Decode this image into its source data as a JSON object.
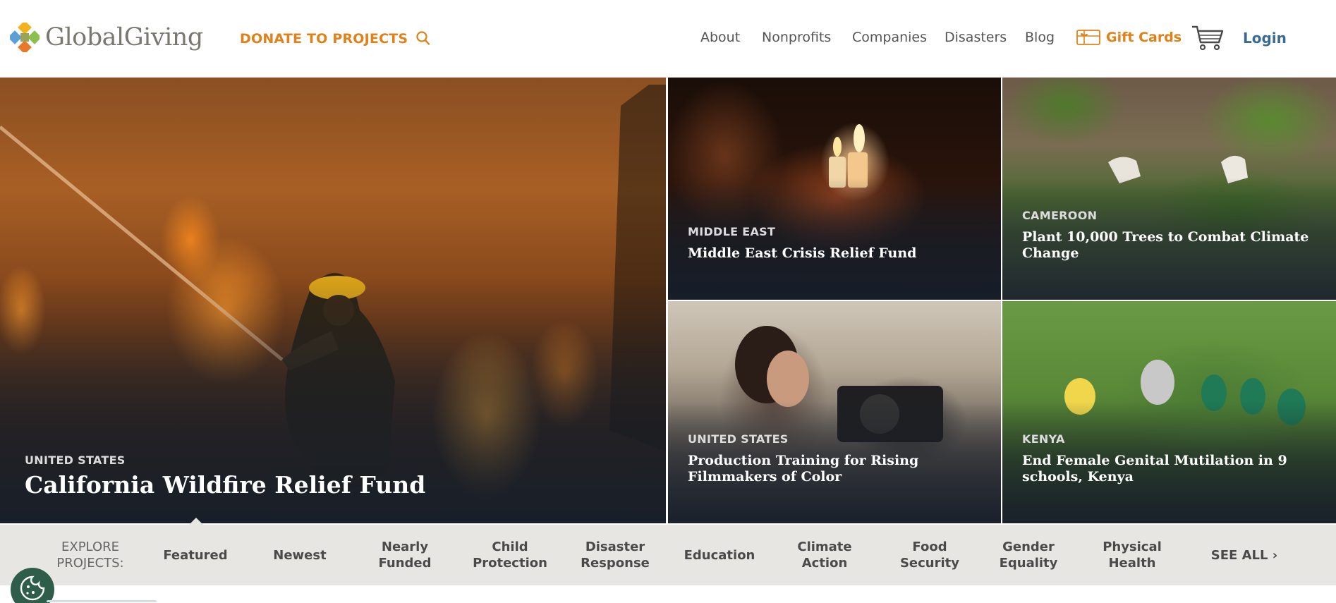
{
  "header": {
    "logo_text": "GlobalGiving",
    "donate_label": "DONATE TO PROJECTS",
    "nav": [
      "About",
      "Nonprofits",
      "Companies",
      "Disasters",
      "Blog"
    ],
    "gift_cards_label": "Gift Cards",
    "login_label": "Login"
  },
  "tiles": {
    "main": {
      "location": "UNITED STATES",
      "title": "California Wildfire Relief Fund"
    },
    "t1": {
      "location": "MIDDLE EAST",
      "title": "Middle East Crisis Relief Fund"
    },
    "t2": {
      "location": "CAMEROON",
      "title": "Plant 10,000 Trees to Combat Climate Change"
    },
    "t3": {
      "location": "UNITED STATES",
      "title": "Production Training for Rising Filmmakers of Color"
    },
    "t4": {
      "location": "KENYA",
      "title": "End Female Genital Mutilation in 9 schools, Kenya"
    }
  },
  "explore": {
    "label": "EXPLORE PROJECTS:",
    "categories": [
      "Featured",
      "Newest",
      "Nearly Funded",
      "Child Protection",
      "Disaster Response",
      "Education",
      "Climate Action",
      "Food Security",
      "Gender Equality",
      "Physical Health"
    ],
    "see_all": "SEE ALL ›",
    "selected": "Featured"
  },
  "icons": [
    "logo-mark-icon",
    "search-icon",
    "gift-card-icon",
    "cart-icon",
    "cookie-icon"
  ],
  "colors": {
    "accent_orange": "#e08119",
    "login_blue": "#3c6a8f",
    "explore_bar": "#e8e6e2",
    "cookie_green": "#2e5d4a"
  }
}
